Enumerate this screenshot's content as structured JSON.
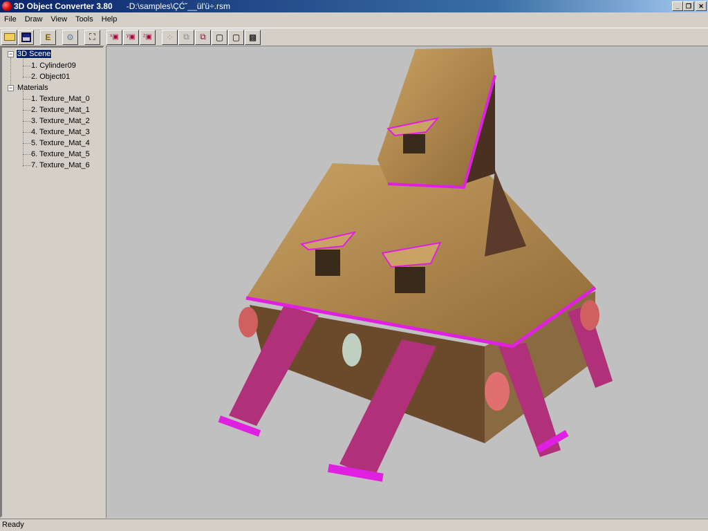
{
  "window": {
    "app_title": "3D Object Converter 3.80",
    "file_title": "-D:\\samples\\ÇĆ˘__ül'ü÷.rsm",
    "minimize": "_",
    "maximize": "❐",
    "close": "✕"
  },
  "menu": [
    "File",
    "Draw",
    "View",
    "Tools",
    "Help"
  ],
  "toolbar": [
    "open-icon",
    "save-icon",
    "tree-icon",
    "settings-gear-icon",
    "zoom-extents-icon",
    "rotate-x-icon",
    "rotate-y-icon",
    "rotate-z-icon",
    "points-view-icon",
    "wireframe-view-icon",
    "edges-view-icon",
    "flat-view-icon",
    "smooth-view-icon",
    "textured-view-icon"
  ],
  "tree": {
    "scene": {
      "label": "3D Scene",
      "items": [
        "1.   Cylinder09",
        "2.   Object01"
      ]
    },
    "materials": {
      "label": "Materials",
      "items": [
        "1.   Texture_Mat_0",
        "2.   Texture_Mat_1",
        "3.   Texture_Mat_2",
        "4.   Texture_Mat_3",
        "5.   Texture_Mat_4",
        "6.   Texture_Mat_5",
        "7.   Texture_Mat_6"
      ]
    }
  },
  "status": "Ready",
  "colors": {
    "viewport": "#c0c0c0",
    "thatch": "#b08a4e",
    "trim": "#e020e0",
    "wood": "#6a4a2a"
  }
}
